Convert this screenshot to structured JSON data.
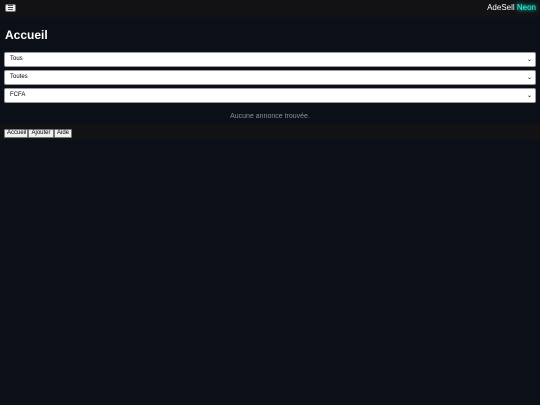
{
  "header": {
    "menu_icon": "☰",
    "brand_main": "AdeSell ",
    "brand_accent": "Neon",
    "accent_color": "#2ef2d8"
  },
  "main": {
    "title": "Accueil",
    "filters": [
      {
        "selected": "Tous"
      },
      {
        "selected": "Toutes"
      },
      {
        "selected": "FCFA"
      }
    ],
    "empty_message": "Aucune annonce trouvée."
  },
  "nav": {
    "buttons": [
      "Accueil",
      "Ajouter",
      "Aide"
    ]
  }
}
